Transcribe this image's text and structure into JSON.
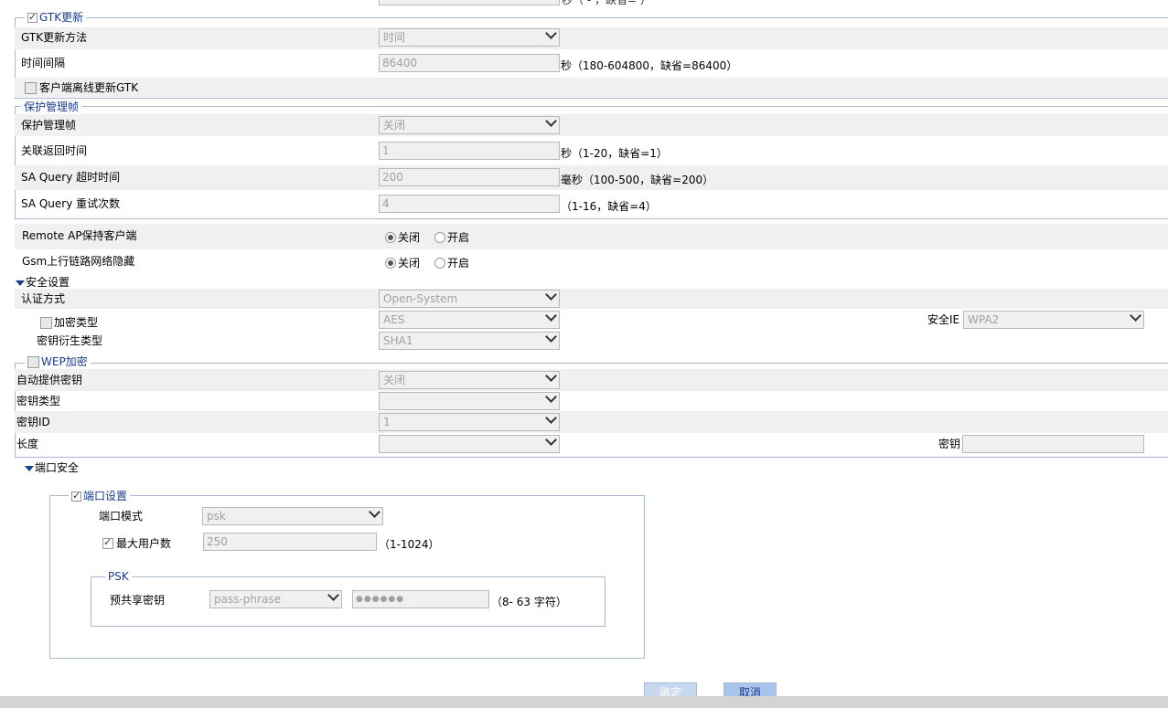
{
  "top_partial": {
    "hint": "秒（    -      ，缺省=    ）"
  },
  "gtk": {
    "legend": "GTK更新",
    "checked": true,
    "method_label": "GTK更新方法",
    "method_value": "时间",
    "interval_label": "时间间隔",
    "interval_value": "86400",
    "interval_hint": "秒（180-604800，缺省=86400）",
    "offline_label": "客户端离线更新GTK",
    "offline_checked": false
  },
  "pmf": {
    "legend": "保护管理帧",
    "pmf_label": "保护管理帧",
    "pmf_value": "关闭",
    "assoc_label": "关联返回时间",
    "assoc_value": "1",
    "assoc_hint": "秒（1-20，缺省=1）",
    "sa_timeout_label": "SA Query 超时时间",
    "sa_timeout_value": "200",
    "sa_timeout_hint": "毫秒（100-500，缺省=200）",
    "sa_retry_label": "SA Query 重试次数",
    "sa_retry_value": "4",
    "sa_retry_hint": "（1-16，缺省=4）"
  },
  "remote_ap": {
    "label": "Remote AP保持客户端",
    "opt_off": "关闭",
    "opt_on": "开启",
    "selected": "off"
  },
  "gsm": {
    "label": "Gsm上行链路网络隐藏",
    "opt_off": "关闭",
    "opt_on": "开启",
    "selected": "off"
  },
  "security": {
    "title": "安全设置",
    "auth_label": "认证方式",
    "auth_value": "Open-System",
    "encrypt_label": "加密类型",
    "encrypt_checked": false,
    "encrypt_value": "AES",
    "ie_label": "安全IE",
    "ie_value": "WPA2",
    "kdf_label": "密钥衍生类型",
    "kdf_value": "SHA1"
  },
  "wep": {
    "legend": "WEP加密",
    "checked": false,
    "auto_label": "自动提供密钥",
    "auto_value": "关闭",
    "keytype_label": "密钥类型",
    "keytype_value": "",
    "keyid_label": "密钥ID",
    "keyid_value": "1",
    "length_label": "长度",
    "length_value": "",
    "key_label": "密钥",
    "key_value": ""
  },
  "port_security": {
    "title": "端口安全",
    "settings_legend": "端口设置",
    "settings_checked": true,
    "mode_label": "端口模式",
    "mode_value": "psk",
    "max_users_label": "最大用户数",
    "max_users_checked": true,
    "max_users_value": "250",
    "max_users_hint": "（1-1024）",
    "psk_legend": "PSK",
    "psk_label": "预共享密钥",
    "psk_type_value": "pass-phrase",
    "psk_value": "●●●●●●",
    "psk_hint": "（8- 63 字符）"
  },
  "buttons": {
    "ok": "确定",
    "cancel": "取消"
  }
}
